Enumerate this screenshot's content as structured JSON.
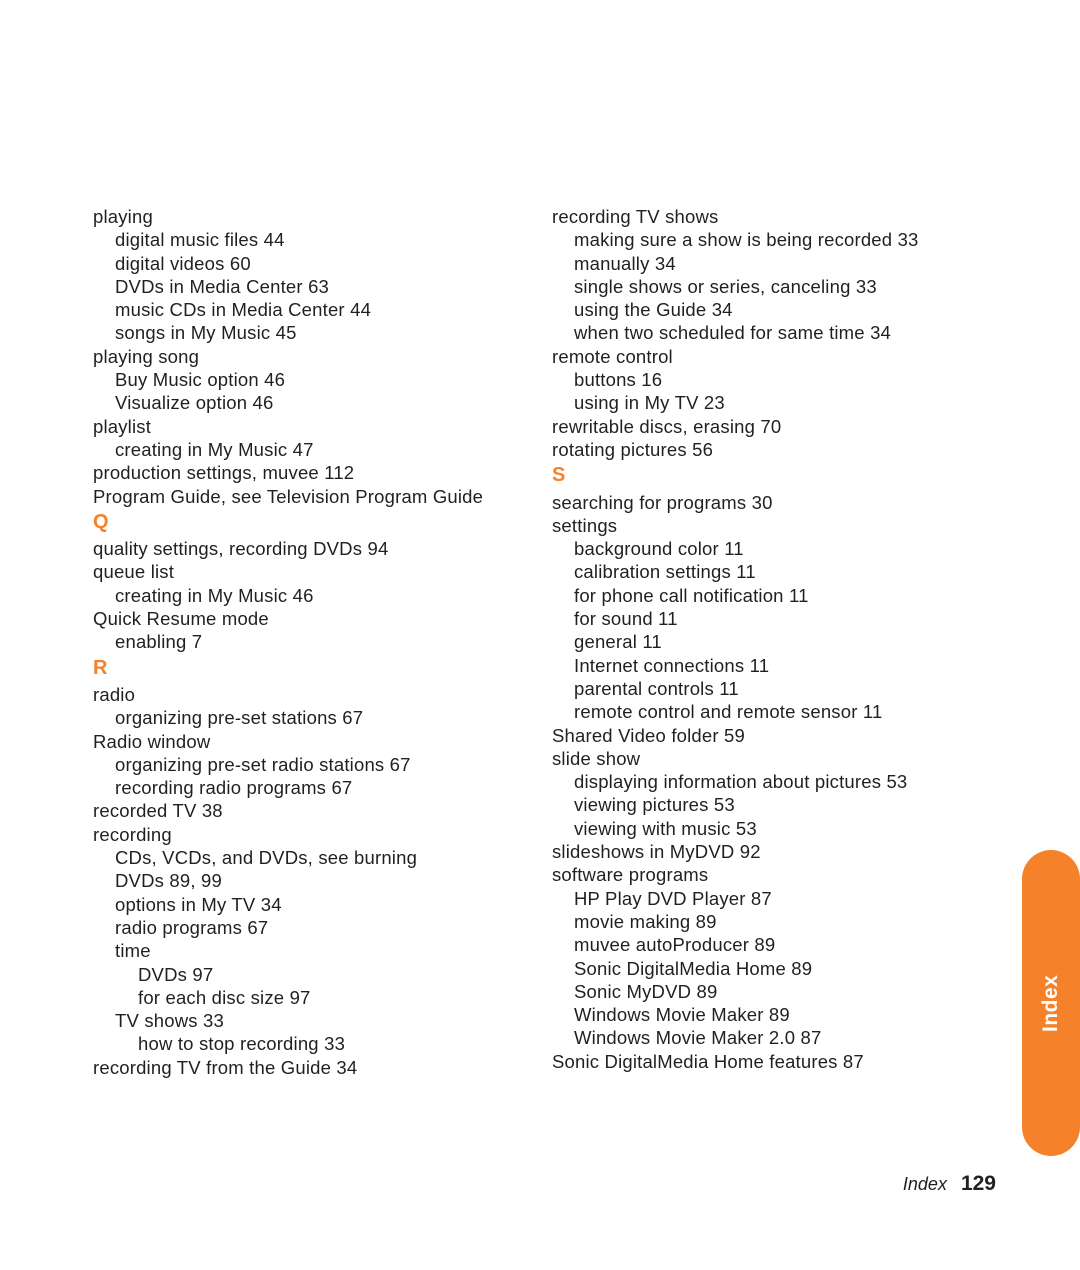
{
  "page": {
    "footer_label": "Index",
    "footer_page_number": "129",
    "tab_label": "Index",
    "accent_color": "#F5822A",
    "text_color": "#231f20",
    "background_color": "#ffffff"
  },
  "columns": {
    "left": [
      {
        "type": "entry",
        "level": 0,
        "text": "playing"
      },
      {
        "type": "entry",
        "level": 1,
        "text": "digital music files 44"
      },
      {
        "type": "entry",
        "level": 1,
        "text": "digital videos 60"
      },
      {
        "type": "entry",
        "level": 1,
        "text": "DVDs in Media Center 63"
      },
      {
        "type": "entry",
        "level": 1,
        "text": "music CDs in Media Center 44"
      },
      {
        "type": "entry",
        "level": 1,
        "text": "songs in My Music 45"
      },
      {
        "type": "entry",
        "level": 0,
        "text": "playing song"
      },
      {
        "type": "entry",
        "level": 1,
        "text": "Buy Music option 46"
      },
      {
        "type": "entry",
        "level": 1,
        "text": "Visualize option 46"
      },
      {
        "type": "entry",
        "level": 0,
        "text": "playlist"
      },
      {
        "type": "entry",
        "level": 1,
        "text": "creating in My Music 47"
      },
      {
        "type": "entry",
        "level": 0,
        "text": "production settings, muvee 112"
      },
      {
        "type": "entry",
        "level": 0,
        "text": "Program Guide, see Television Program Guide"
      },
      {
        "type": "section",
        "level": 0,
        "text": "Q"
      },
      {
        "type": "entry",
        "level": 0,
        "text": "quality settings, recording DVDs 94"
      },
      {
        "type": "entry",
        "level": 0,
        "text": "queue list"
      },
      {
        "type": "entry",
        "level": 1,
        "text": "creating in My Music 46"
      },
      {
        "type": "entry",
        "level": 0,
        "text": "Quick Resume mode"
      },
      {
        "type": "entry",
        "level": 1,
        "text": "enabling 7"
      },
      {
        "type": "section",
        "level": 0,
        "text": "R"
      },
      {
        "type": "entry",
        "level": 0,
        "text": "radio"
      },
      {
        "type": "entry",
        "level": 1,
        "text": "organizing pre-set stations 67"
      },
      {
        "type": "entry",
        "level": 0,
        "text": "Radio window"
      },
      {
        "type": "entry",
        "level": 1,
        "text": "organizing pre-set radio stations 67"
      },
      {
        "type": "entry",
        "level": 1,
        "text": "recording radio programs 67"
      },
      {
        "type": "entry",
        "level": 0,
        "text": "recorded TV 38"
      },
      {
        "type": "entry",
        "level": 0,
        "text": "recording"
      },
      {
        "type": "entry",
        "level": 1,
        "text": "CDs, VCDs, and DVDs, see burning"
      },
      {
        "type": "entry",
        "level": 1,
        "text": "DVDs 89, 99"
      },
      {
        "type": "entry",
        "level": 1,
        "text": "options in My TV 34"
      },
      {
        "type": "entry",
        "level": 1,
        "text": "radio programs 67"
      },
      {
        "type": "entry",
        "level": 1,
        "text": "time"
      },
      {
        "type": "entry",
        "level": 2,
        "text": "DVDs 97"
      },
      {
        "type": "entry",
        "level": 2,
        "text": "for each disc size 97"
      },
      {
        "type": "entry",
        "level": 1,
        "text": "TV shows 33"
      },
      {
        "type": "entry",
        "level": 2,
        "text": "how to stop recording 33"
      },
      {
        "type": "entry",
        "level": 0,
        "text": "recording TV from the Guide 34"
      }
    ],
    "right": [
      {
        "type": "entry",
        "level": 0,
        "text": "recording TV shows"
      },
      {
        "type": "entry",
        "level": 1,
        "text": "making sure a show is being recorded 33"
      },
      {
        "type": "entry",
        "level": 1,
        "text": "manually 34"
      },
      {
        "type": "entry",
        "level": 1,
        "text": "single shows or series, canceling 33"
      },
      {
        "type": "entry",
        "level": 1,
        "text": "using the Guide 34"
      },
      {
        "type": "entry",
        "level": 1,
        "text": "when two scheduled for same time 34"
      },
      {
        "type": "entry",
        "level": 0,
        "text": "remote control"
      },
      {
        "type": "entry",
        "level": 1,
        "text": "buttons 16"
      },
      {
        "type": "entry",
        "level": 1,
        "text": "using in My TV 23"
      },
      {
        "type": "entry",
        "level": 0,
        "text": "rewritable discs, erasing 70"
      },
      {
        "type": "entry",
        "level": 0,
        "text": "rotating pictures 56"
      },
      {
        "type": "section",
        "level": 0,
        "text": "S"
      },
      {
        "type": "entry",
        "level": 0,
        "text": "searching for programs 30"
      },
      {
        "type": "entry",
        "level": 0,
        "text": "settings"
      },
      {
        "type": "entry",
        "level": 1,
        "text": "background color 11"
      },
      {
        "type": "entry",
        "level": 1,
        "text": "calibration settings 11"
      },
      {
        "type": "entry",
        "level": 1,
        "text": "for phone call notification 11"
      },
      {
        "type": "entry",
        "level": 1,
        "text": "for sound 11"
      },
      {
        "type": "entry",
        "level": 1,
        "text": "general 11"
      },
      {
        "type": "entry",
        "level": 1,
        "text": "Internet connections 11"
      },
      {
        "type": "entry",
        "level": 1,
        "text": "parental controls 11"
      },
      {
        "type": "entry",
        "level": 1,
        "text": "remote control and remote sensor 11"
      },
      {
        "type": "entry",
        "level": 0,
        "text": "Shared Video folder 59"
      },
      {
        "type": "entry",
        "level": 0,
        "text": "slide show"
      },
      {
        "type": "entry",
        "level": 1,
        "text": "displaying information about pictures 53"
      },
      {
        "type": "entry",
        "level": 1,
        "text": "viewing pictures 53"
      },
      {
        "type": "entry",
        "level": 1,
        "text": "viewing with music 53"
      },
      {
        "type": "entry",
        "level": 0,
        "text": "slideshows in MyDVD 92"
      },
      {
        "type": "entry",
        "level": 0,
        "text": "software programs"
      },
      {
        "type": "entry",
        "level": 1,
        "text": "HP Play DVD Player 87"
      },
      {
        "type": "entry",
        "level": 1,
        "text": "movie making 89"
      },
      {
        "type": "entry",
        "level": 1,
        "text": "muvee autoProducer 89"
      },
      {
        "type": "entry",
        "level": 1,
        "text": "Sonic DigitalMedia Home 89"
      },
      {
        "type": "entry",
        "level": 1,
        "text": "Sonic MyDVD 89"
      },
      {
        "type": "entry",
        "level": 1,
        "text": "Windows Movie Maker 89"
      },
      {
        "type": "entry",
        "level": 1,
        "text": "Windows Movie Maker 2.0 87"
      },
      {
        "type": "entry",
        "level": 0,
        "text": "Sonic DigitalMedia Home features 87"
      }
    ]
  }
}
